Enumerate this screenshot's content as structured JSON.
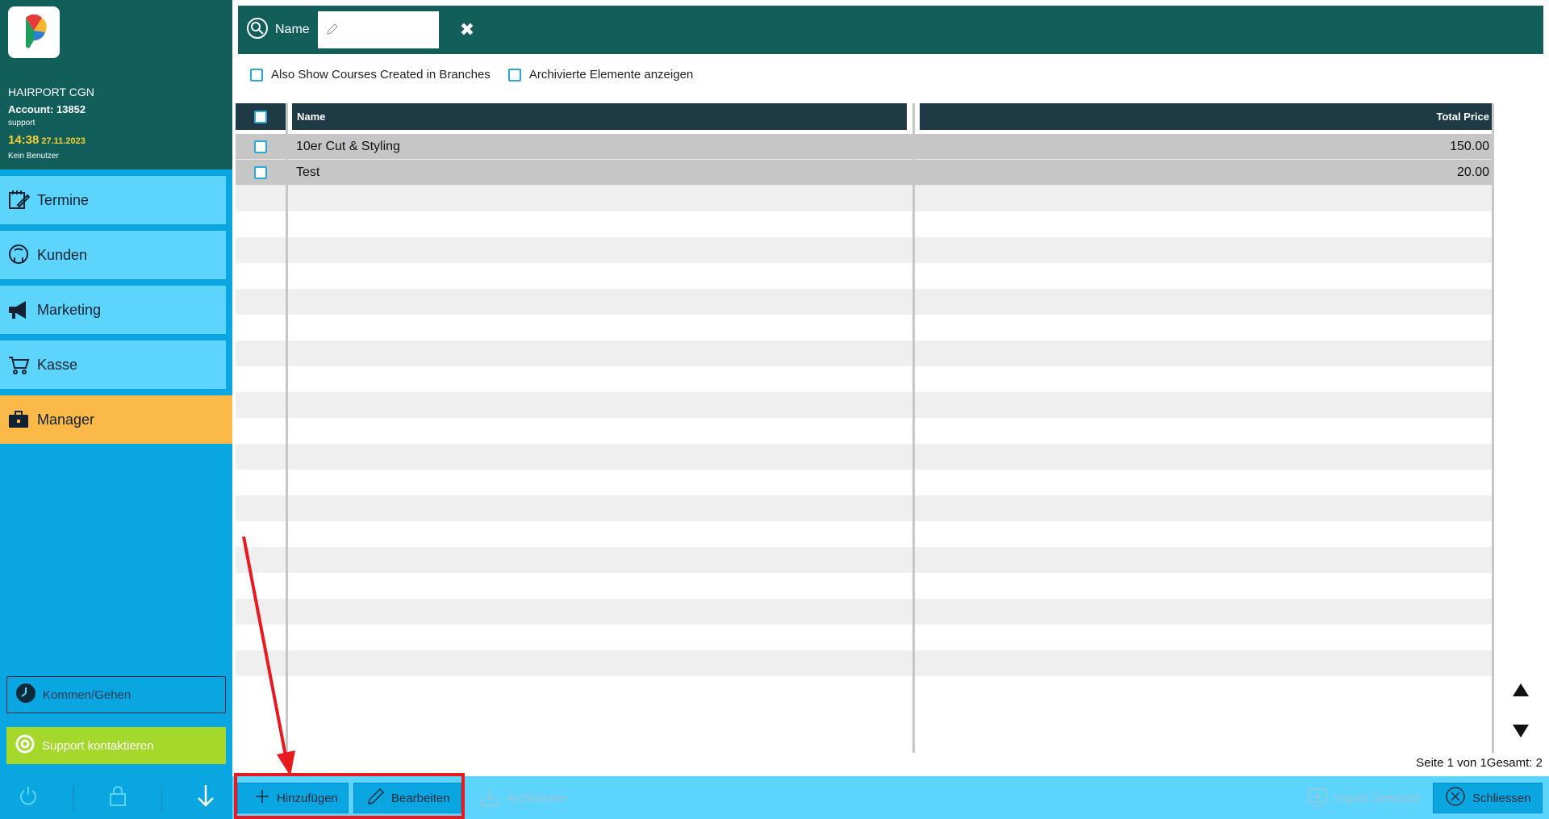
{
  "sidebar": {
    "branch": "HAIRPORT CGN",
    "account": "Account: 13852",
    "user": "support",
    "time": "14:38",
    "date": "27.11.2023",
    "no_user": "Kein Benutzer",
    "items": [
      {
        "label": "Termine",
        "icon": "calendar-pen-icon"
      },
      {
        "label": "Kunden",
        "icon": "customer-head-icon"
      },
      {
        "label": "Marketing",
        "icon": "megaphone-icon"
      },
      {
        "label": "Kasse",
        "icon": "cart-icon"
      },
      {
        "label": "Manager",
        "icon": "briefcase-icon",
        "active": true
      }
    ],
    "clock_button": "Kommen/Gehen",
    "support_button": "Support kontaktieren"
  },
  "search": {
    "label": "Name",
    "value": ""
  },
  "filters": {
    "branches": "Also Show Courses Created in Branches",
    "archived": "Archivierte Elemente anzeigen"
  },
  "table": {
    "columns": [
      "Name",
      "Total Price"
    ],
    "rows": [
      {
        "name": "10er Cut & Styling",
        "price": "150.00"
      },
      {
        "name": "Test",
        "price": "20.00"
      }
    ]
  },
  "pager": {
    "text": "Seite 1 von 1Gesamt: 2"
  },
  "toolbar": {
    "add": "Hinzufügen",
    "edit": "Bearbeiten",
    "archive": "Archivieren",
    "import": "Import Selected",
    "close": "Schliessen"
  },
  "colors": {
    "sidebar_blue": "#0aa6e2",
    "header_teal": "#115e5b",
    "nav_light": "#5cd4fb",
    "active_orange": "#fbb948",
    "support_green": "#a4d82a",
    "highlight_red": "#e8191f"
  }
}
